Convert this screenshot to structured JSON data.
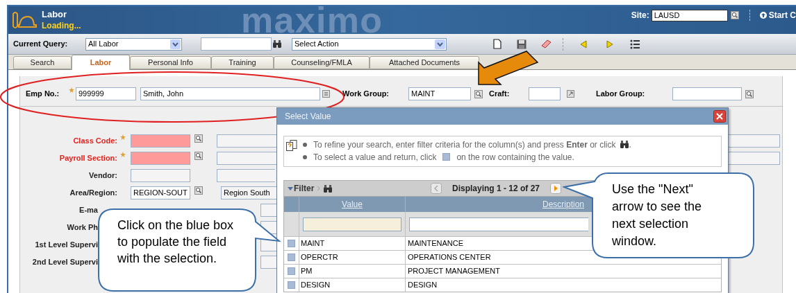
{
  "header": {
    "app_title": "Labor",
    "status": "Loading...",
    "logo_text": "maximo",
    "site_label": "Site:",
    "site_value": "LAUSD",
    "start_center": "Start C"
  },
  "toolbar": {
    "query_label": "Current Query:",
    "query_value": "All Labor",
    "action_value": "Select Action"
  },
  "tabs": [
    {
      "label": "Search",
      "selected": false
    },
    {
      "label": "Labor",
      "selected": true
    },
    {
      "label": "Personal Info",
      "selected": false
    },
    {
      "label": "Training",
      "selected": false
    },
    {
      "label": "Counseling/FMLA",
      "selected": false
    },
    {
      "label": "Attached Documents",
      "selected": false
    }
  ],
  "form": {
    "emp_label": "Emp No.:",
    "emp_no": "999999",
    "emp_name": "Smith, John",
    "work_group_label": "Work Group:",
    "work_group": "MAINT",
    "craft_label": "Craft:",
    "labor_group_label": "Labor Group:",
    "fields": [
      {
        "kind": "lookup",
        "label": "Class Code:",
        "required": true
      },
      {
        "kind": "lookup",
        "label": "Payroll Section:",
        "required": true
      },
      {
        "kind": "plain",
        "label": "Vendor:",
        "required": false
      },
      {
        "kind": "lookup",
        "label": "Area/Region:",
        "required": false,
        "value": "REGION-SOUT",
        "description": "Region South"
      },
      {
        "kind": "partial",
        "label": "E-ma",
        "required": false
      },
      {
        "kind": "partial",
        "label": "Work Ph",
        "required": false
      },
      {
        "kind": "partial",
        "label": "1st Level Supervi",
        "required": false
      },
      {
        "kind": "partial",
        "label": "2nd Level Supervi",
        "required": false
      }
    ]
  },
  "dialog": {
    "title": "Select Value",
    "tips": [
      {
        "text": "To refine your search, enter filter criteria for the column(s) and press **Enter** or click",
        "after": "."
      },
      {
        "text": "To select a value and return, click",
        "after": "on the row containing the value."
      }
    ],
    "filter_label": "Filter",
    "paging": "Displaying 1 - 12 of 27",
    "columns": [
      "Value",
      "Description"
    ],
    "rows": [
      {
        "value": "MAINT",
        "description": "MAINTENANCE"
      },
      {
        "value": "OPERCTR",
        "description": "OPERATIONS CENTER"
      },
      {
        "value": "PM",
        "description": "PROJECT MANAGEMENT"
      },
      {
        "value": "DESIGN",
        "description": "DESIGN"
      }
    ]
  },
  "callouts": [
    {
      "text": "Click on the blue box to populate the field with the selection."
    },
    {
      "text": "Use the \"Next\" arrow to see the next selection window."
    }
  ]
}
